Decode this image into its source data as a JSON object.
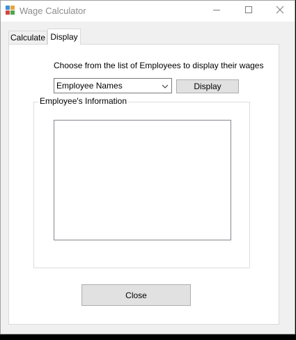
{
  "window": {
    "title": "Wage Calculator"
  },
  "tabs": [
    {
      "label": "Calculate",
      "selected": false
    },
    {
      "label": "Display",
      "selected": true
    }
  ],
  "display_tab": {
    "prompt": "Choose from the list of Employees to display their wages",
    "employee_combo": {
      "selected_value": "Employee Names"
    },
    "display_button_label": "Display",
    "group": {
      "label": "Employee's Information",
      "list_items": []
    },
    "close_button_label": "Close"
  },
  "icons": {
    "app": "app-icon",
    "minimize": "minimize-icon",
    "maximize": "maximize-icon",
    "close": "close-icon",
    "dropdown": "chevron-down-icon"
  }
}
